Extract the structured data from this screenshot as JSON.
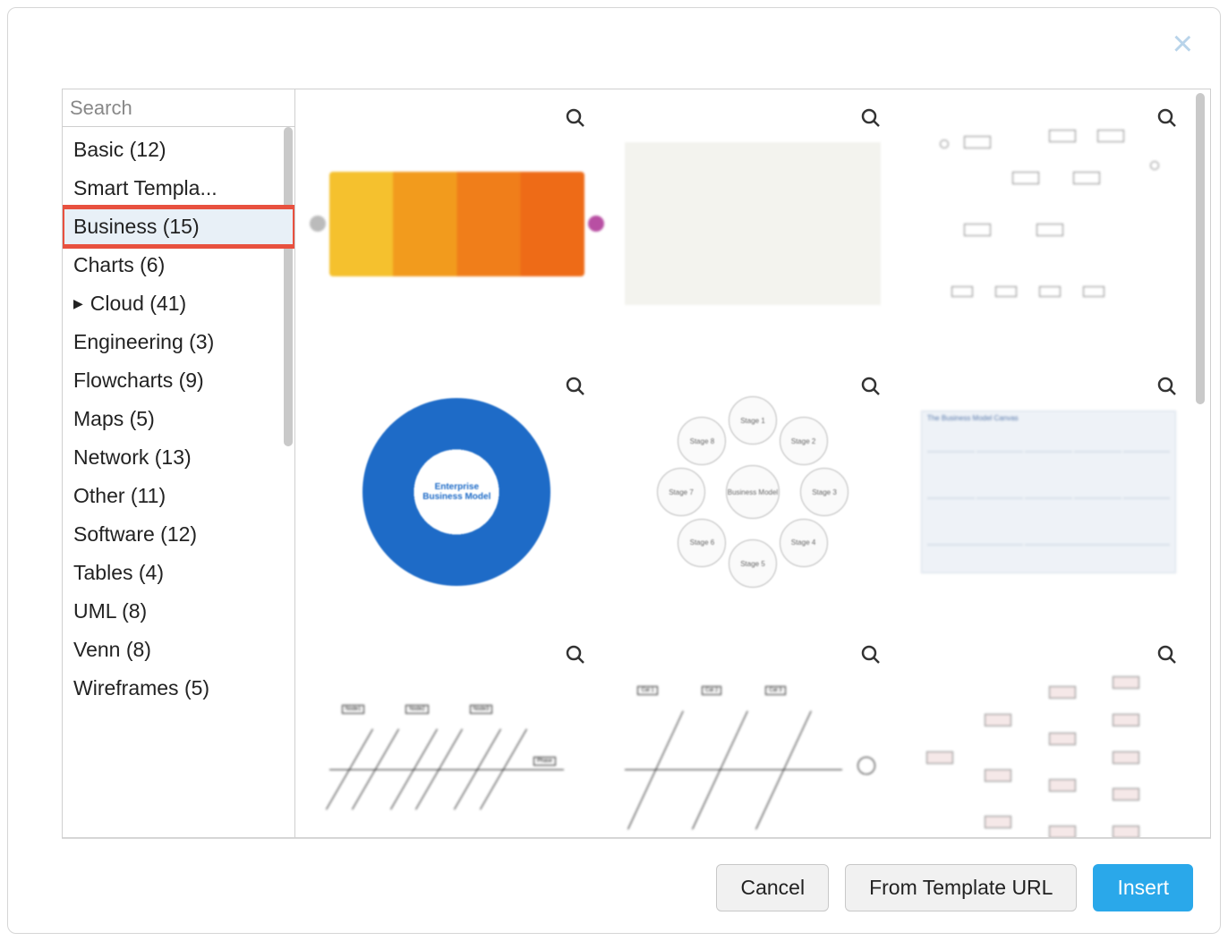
{
  "search": {
    "placeholder": "Search"
  },
  "categories": [
    {
      "label": "Basic (12)",
      "expandable": false,
      "selected": false,
      "highlighted": false
    },
    {
      "label": "Smart Templa...",
      "expandable": false,
      "selected": false,
      "highlighted": false
    },
    {
      "label": "Business (15)",
      "expandable": false,
      "selected": true,
      "highlighted": true
    },
    {
      "label": "Charts (6)",
      "expandable": false,
      "selected": false,
      "highlighted": false
    },
    {
      "label": "Cloud (41)",
      "expandable": true,
      "selected": false,
      "highlighted": false
    },
    {
      "label": "Engineering (3)",
      "expandable": false,
      "selected": false,
      "highlighted": false
    },
    {
      "label": "Flowcharts (9)",
      "expandable": false,
      "selected": false,
      "highlighted": false
    },
    {
      "label": "Maps (5)",
      "expandable": false,
      "selected": false,
      "highlighted": false
    },
    {
      "label": "Network (13)",
      "expandable": false,
      "selected": false,
      "highlighted": false
    },
    {
      "label": "Other (11)",
      "expandable": false,
      "selected": false,
      "highlighted": false
    },
    {
      "label": "Software (12)",
      "expandable": false,
      "selected": false,
      "highlighted": false
    },
    {
      "label": "Tables (4)",
      "expandable": false,
      "selected": false,
      "highlighted": false
    },
    {
      "label": "UML (8)",
      "expandable": false,
      "selected": false,
      "highlighted": false
    },
    {
      "label": "Venn (8)",
      "expandable": false,
      "selected": false,
      "highlighted": false
    },
    {
      "label": "Wireframes (5)",
      "expandable": false,
      "selected": false,
      "highlighted": false
    }
  ],
  "templates": {
    "t4_center": "Enterprise Business Model",
    "t5_center": "Business Model",
    "t5_stages": [
      "Stage 1",
      "Stage 2",
      "Stage 3",
      "Stage 4",
      "Stage 5",
      "Stage 6",
      "Stage 7",
      "Stage 8"
    ]
  },
  "footer": {
    "cancel": "Cancel",
    "from_url": "From Template URL",
    "insert": "Insert"
  }
}
